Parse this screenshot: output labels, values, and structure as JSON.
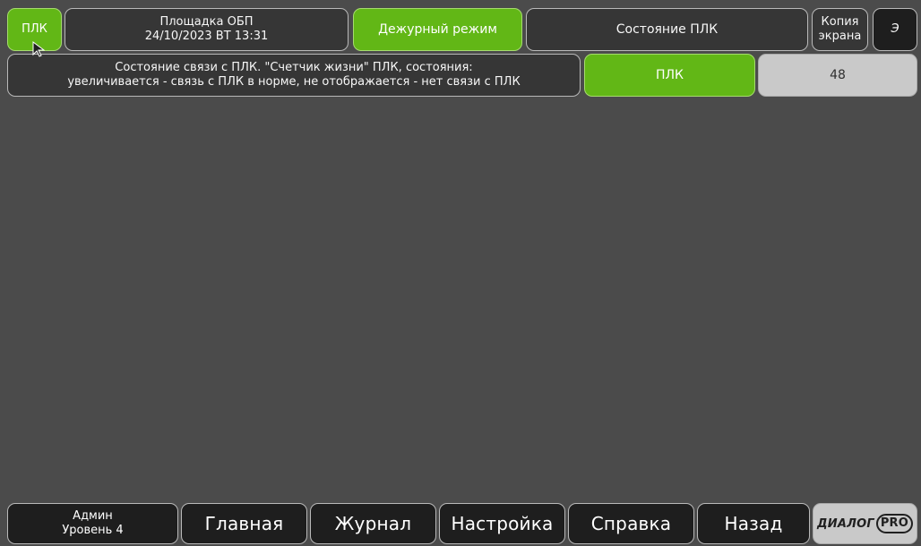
{
  "header": {
    "plc_button": "ПЛК",
    "site_title": "Площадка ОБП",
    "datetime": "24/10/2023 ВТ 13:31",
    "mode_label": "Дежурный режим",
    "status_title": "Состояние ПЛК",
    "screen_copy_line1": "Копия",
    "screen_copy_line2": "экрана",
    "energy_label": "Э"
  },
  "status_row": {
    "description_line1": "Состояние связи с ПЛК. \"Счетчик жизни\" ПЛК, состояния:",
    "description_line2": "увеличивается - связь с ПЛК в норме, не отображается - нет связи с ПЛК",
    "plc_indicator": "ПЛК",
    "life_counter": "48"
  },
  "footer": {
    "user_name": "Админ",
    "user_level": "Уровень 4",
    "tabs": [
      {
        "label": "Главная"
      },
      {
        "label": "Журнал"
      },
      {
        "label": "Настройка"
      },
      {
        "label": "Справка"
      },
      {
        "label": "Назад"
      }
    ],
    "logo_text": "ДИАЛОГ",
    "logo_badge": "PRO"
  },
  "icons": {
    "cursor": "mouse-cursor-icon"
  },
  "colors": {
    "background": "#4b4b4b",
    "panel": "#363636",
    "green": "#62b716",
    "light": "#c9c9c9"
  }
}
